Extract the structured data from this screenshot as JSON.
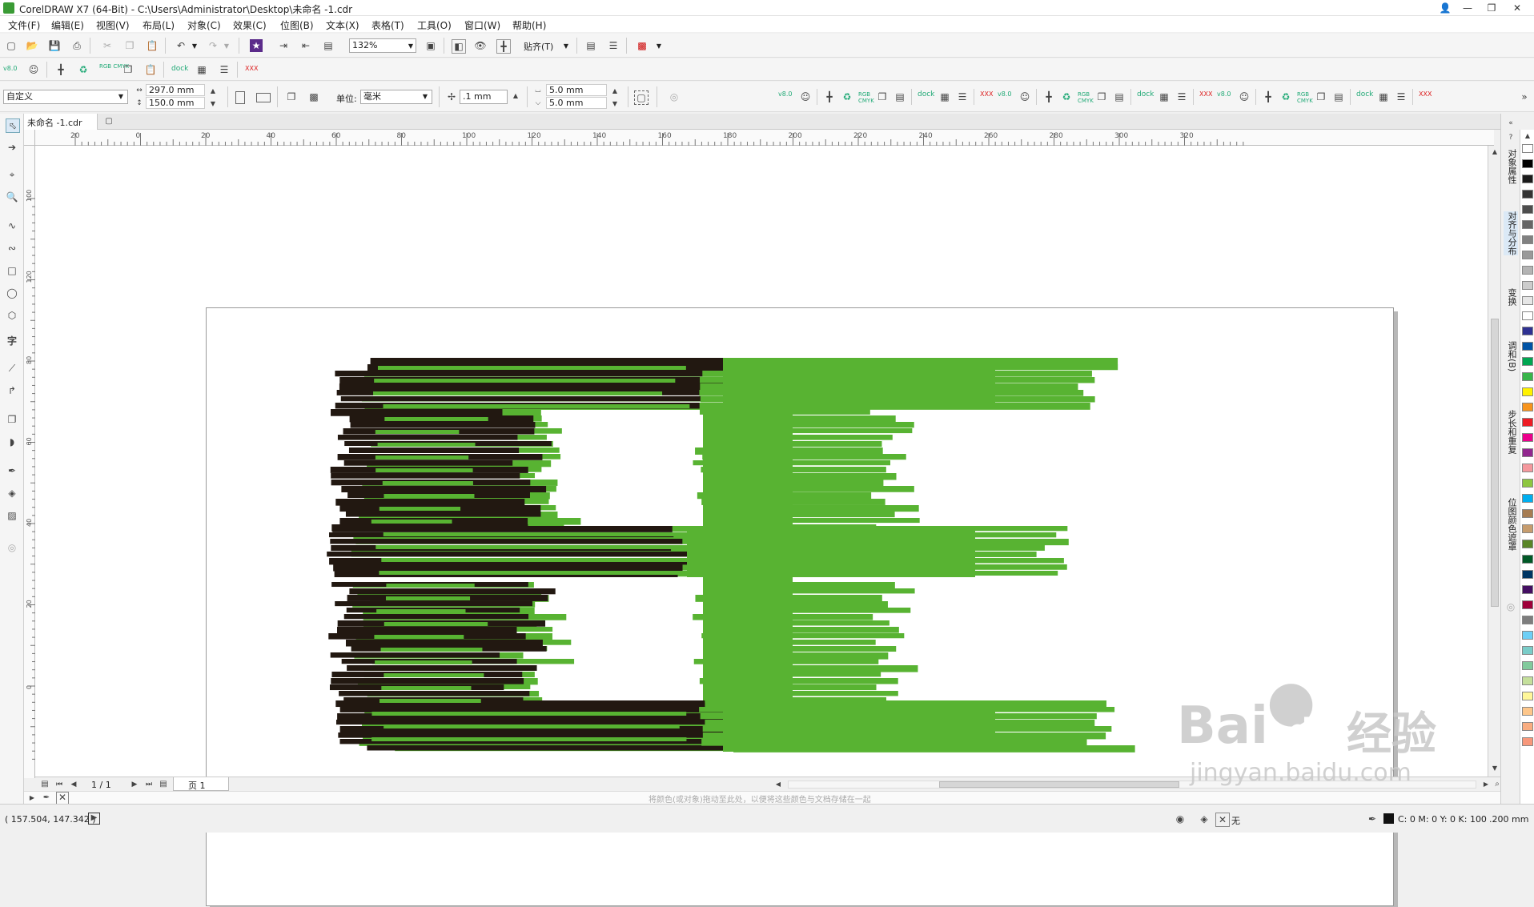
{
  "window": {
    "title": "CorelDRAW X7 (64-Bit) - C:\\Users\\Administrator\\Desktop\\未命名 -1.cdr"
  },
  "menu": [
    "文件(F)",
    "编辑(E)",
    "视图(V)",
    "布局(L)",
    "对象(C)",
    "效果(C)",
    "位图(B)",
    "文本(X)",
    "表格(T)",
    "工具(O)",
    "窗口(W)",
    "帮助(H)"
  ],
  "standard": {
    "zoom": "132%",
    "snap_label": "贴齐(T)"
  },
  "property": {
    "page_preset": "自定义",
    "width": "297.0 mm",
    "height": "150.0 mm",
    "unit_label": "单位:",
    "unit_value": "毫米",
    "nudge": ".1 mm",
    "dup_x": "5.0 mm",
    "dup_y": "5.0 mm",
    "rgb_cmyk": "RGB CMYK",
    "v80": "v8.0",
    "dock_label": "dock",
    "xxx": "XXX"
  },
  "document_tab": "未命名 -1.cdr",
  "ruler_h_labels": [
    "20",
    "0",
    "20",
    "40",
    "60",
    "80",
    "100",
    "120",
    "140",
    "160",
    "180",
    "200",
    "220",
    "240",
    "260",
    "280",
    "300",
    "320"
  ],
  "ruler_h_unit": "毫米",
  "ruler_v_labels": [
    "100",
    "120",
    "80",
    "60",
    "40",
    "20",
    "0"
  ],
  "artwork_colors": {
    "green": "#58b332",
    "dark": "#221811"
  },
  "dockers": [
    "对象属性",
    "对齐与分布",
    "变换",
    "调和(B)",
    "步长和重复",
    "位图颜色遮罩"
  ],
  "palette": [
    "#ffffff",
    "#000000",
    "#1a1a1a",
    "#333333",
    "#4d4d4d",
    "#666666",
    "#808080",
    "#999999",
    "#b3b3b3",
    "#cccccc",
    "#e6e6e6",
    "#ffffff",
    "#2e3192",
    "#0054a6",
    "#00a651",
    "#39b54a",
    "#fff200",
    "#f7941d",
    "#ed1c24",
    "#ec008c",
    "#92278f",
    "#f5989d",
    "#8dc63f",
    "#00aeef",
    "#a67c52",
    "#c69c6d",
    "#598527",
    "#005826",
    "#003663",
    "#440e62",
    "#9e0039",
    "#7d7d7d",
    "#6dcff6",
    "#7accc8",
    "#82ca9c",
    "#c4df9b",
    "#fff799",
    "#fdc68a",
    "#f9ad81",
    "#f7977a"
  ],
  "pagebar": {
    "page_count": "1 / 1",
    "page_tab": "页 1"
  },
  "colorbar_hint": "将颜色(或对象)拖动至此处，以便将这些颜色与文档存储在一起",
  "status": {
    "coords": "( 157.504, 147.342 )",
    "fill_none": "无",
    "color_info": "C: 0 M: 0 Y: 0 K: 100",
    "stroke_width": ".200 mm"
  },
  "watermark": {
    "brand": "Bai",
    "brand2": "du",
    "cn": "经验",
    "url": "jingyan.baidu.com"
  }
}
